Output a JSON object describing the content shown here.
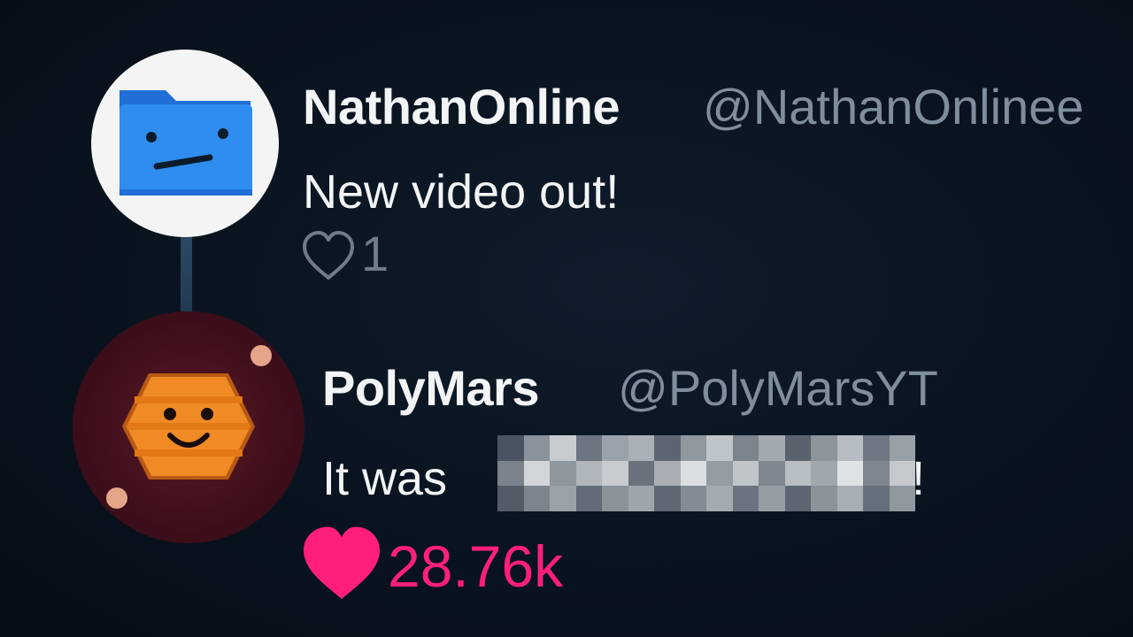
{
  "tweets": [
    {
      "name": "NathanOnline",
      "handle": "@NathanOnlinee",
      "text": "New video out!",
      "likes": "1",
      "liked": false
    },
    {
      "name": "PolyMars",
      "handle": "@PolyMarsYT",
      "text_prefix": "It was",
      "text_suffix": "!",
      "likes": "28.76k",
      "liked": true
    }
  ],
  "colors": {
    "liked": "#ff1f7a",
    "handle": "#7f8e9c",
    "name": "#f2f4f6",
    "folder": "#2f8df0",
    "hexagon": "#f08a24"
  },
  "icons": {
    "avatar1": "folder-face-icon",
    "avatar2": "hexagon-face-icon",
    "like1": "heart-outline-icon",
    "like2": "heart-filled-icon"
  }
}
